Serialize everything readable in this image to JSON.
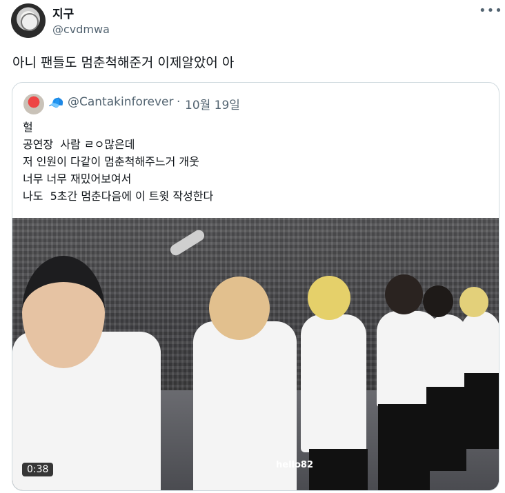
{
  "author": {
    "display_name": "지구",
    "handle": "@cvdmwa"
  },
  "post": {
    "text": "아니 팬들도 멈춘척해준거 이제알았어 아"
  },
  "quoted": {
    "emoji": "🧢",
    "handle": "@Cantakinforever",
    "separator": "·",
    "date": "10월 19일",
    "lines": [
      "헐",
      "공연장  사람 ㄹㅇ많은데",
      "저 인원이 다같이 멈춘척해주느거 개웃",
      "너무 너무 재밌어보여서",
      "나도  5초간 멈춘다음에 이 트윗 작성한다"
    ],
    "video": {
      "duration": "0:38",
      "watermarks": [
        "hello82"
      ]
    }
  },
  "icons": {
    "more": "more-horizontal-icon"
  }
}
